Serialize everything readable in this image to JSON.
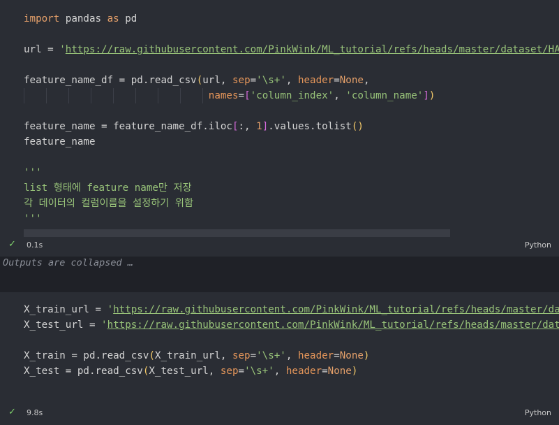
{
  "cell1": {
    "lines": [
      [
        {
          "t": "import",
          "c": "kw"
        },
        {
          "t": " pandas ",
          "c": ""
        },
        {
          "t": "as",
          "c": "kw"
        },
        {
          "t": " pd",
          "c": ""
        }
      ],
      [],
      [
        {
          "t": "url = ",
          "c": ""
        },
        {
          "t": "'",
          "c": "str"
        },
        {
          "t": "https://raw.githubusercontent.com/PinkWink/ML_tutorial/refs/heads/master/dataset/HAR_dataset/features.txt",
          "c": "url"
        }
      ],
      [],
      [
        {
          "t": "feature_name_df = pd.read_csv",
          "c": ""
        },
        {
          "t": "(",
          "c": "paren"
        },
        {
          "t": "url, ",
          "c": ""
        },
        {
          "t": "sep",
          "c": "param"
        },
        {
          "t": "=",
          "c": ""
        },
        {
          "t": "'\\s+'",
          "c": "str"
        },
        {
          "t": ", ",
          "c": ""
        },
        {
          "t": "header",
          "c": "param"
        },
        {
          "t": "=",
          "c": ""
        },
        {
          "t": "None",
          "c": "kw"
        },
        {
          "t": ",",
          "c": ""
        }
      ],
      [
        {
          "t": "                               ",
          "c": "",
          "guides": 9
        },
        {
          "t": "names",
          "c": "param"
        },
        {
          "t": "=",
          "c": ""
        },
        {
          "t": "[",
          "c": "brk"
        },
        {
          "t": "'column_index'",
          "c": "str"
        },
        {
          "t": ", ",
          "c": ""
        },
        {
          "t": "'column_name'",
          "c": "str"
        },
        {
          "t": "]",
          "c": "brk"
        },
        {
          "t": ")",
          "c": "paren"
        }
      ],
      [],
      [
        {
          "t": "feature_name = feature_name_df.iloc",
          "c": ""
        },
        {
          "t": "[",
          "c": "brk"
        },
        {
          "t": ":, ",
          "c": ""
        },
        {
          "t": "1",
          "c": "num"
        },
        {
          "t": "]",
          "c": "brk"
        },
        {
          "t": ".values.tolist",
          "c": ""
        },
        {
          "t": "()",
          "c": "paren"
        }
      ],
      [
        {
          "t": "feature_name",
          "c": ""
        }
      ],
      [],
      [
        {
          "t": "'''",
          "c": "cmt"
        }
      ],
      [
        {
          "t": "list 형태에 feature name만 저장",
          "c": "cmt"
        }
      ],
      [
        {
          "t": "각 데이터의 컬럼이름을 설정하기 위함",
          "c": "cmt"
        }
      ],
      [
        {
          "t": "'''",
          "c": "cmt"
        }
      ]
    ],
    "status_time": "0.1s",
    "status_lang": "Python"
  },
  "collapsed_text": "Outputs are collapsed …",
  "cell2": {
    "lines": [
      [
        {
          "t": "X_train_url = ",
          "c": ""
        },
        {
          "t": "'",
          "c": "str"
        },
        {
          "t": "https://raw.githubusercontent.com/PinkWink/ML_tutorial/refs/heads/master/dataset/HAR_dataset/train/X_train.txt",
          "c": "url"
        }
      ],
      [
        {
          "t": "X_test_url = ",
          "c": ""
        },
        {
          "t": "'",
          "c": "str"
        },
        {
          "t": "https://raw.githubusercontent.com/PinkWink/ML_tutorial/refs/heads/master/dataset/HAR_dataset/test/X_test.txt",
          "c": "url"
        }
      ],
      [],
      [
        {
          "t": "X_train = pd.read_csv",
          "c": ""
        },
        {
          "t": "(",
          "c": "paren"
        },
        {
          "t": "X_train_url, ",
          "c": ""
        },
        {
          "t": "sep",
          "c": "param"
        },
        {
          "t": "=",
          "c": ""
        },
        {
          "t": "'\\s+'",
          "c": "str"
        },
        {
          "t": ", ",
          "c": ""
        },
        {
          "t": "header",
          "c": "param"
        },
        {
          "t": "=",
          "c": ""
        },
        {
          "t": "None",
          "c": "kw"
        },
        {
          "t": ")",
          "c": "paren"
        }
      ],
      [
        {
          "t": "X_test = pd.read_csv",
          "c": ""
        },
        {
          "t": "(",
          "c": "paren"
        },
        {
          "t": "X_test_url, ",
          "c": ""
        },
        {
          "t": "sep",
          "c": "param"
        },
        {
          "t": "=",
          "c": ""
        },
        {
          "t": "'\\s+'",
          "c": "str"
        },
        {
          "t": ", ",
          "c": ""
        },
        {
          "t": "header",
          "c": "param"
        },
        {
          "t": "=",
          "c": ""
        },
        {
          "t": "None",
          "c": "kw"
        },
        {
          "t": ")",
          "c": "paren"
        }
      ]
    ],
    "status_time": "9.8s",
    "status_lang": "Python"
  }
}
